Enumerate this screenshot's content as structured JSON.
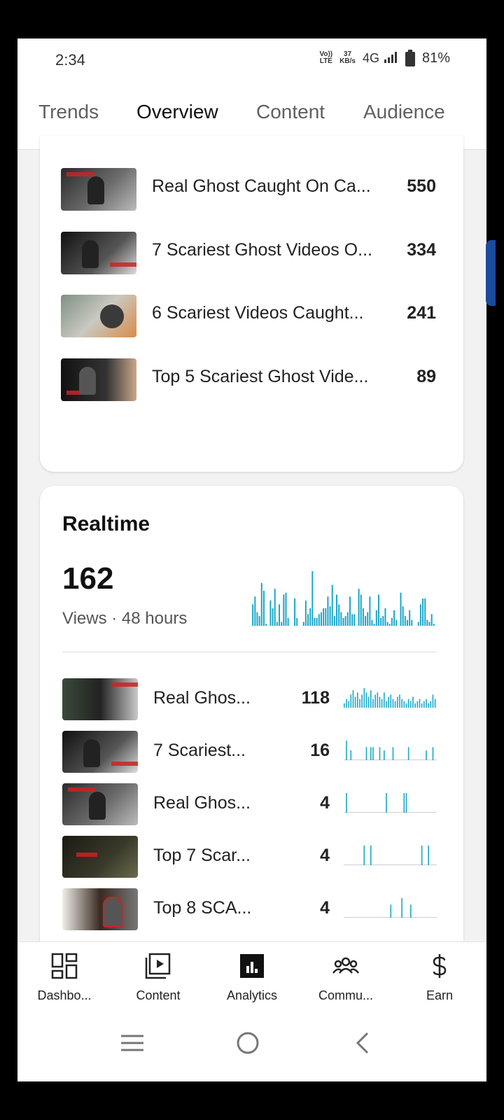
{
  "status_bar": {
    "time": "2:34",
    "volte": "Vo))",
    "lte": "LTE",
    "speed_value": "37",
    "speed_unit": "KB/s",
    "network": "4G",
    "battery": "81%"
  },
  "tabs": [
    {
      "label": "Trends"
    },
    {
      "label": "Overview"
    },
    {
      "label": "Content"
    },
    {
      "label": "Audience"
    }
  ],
  "active_tab": "Overview",
  "top_content": [
    {
      "title": "Real Ghost Caught On Ca...",
      "count": "550"
    },
    {
      "title": "7 Scariest Ghost Videos O...",
      "count": "334"
    },
    {
      "title": "6 Scariest Videos Caught...",
      "count": "241"
    },
    {
      "title": "Top 5 Scariest Ghost Vide...",
      "count": "89"
    }
  ],
  "realtime": {
    "title": "Realtime",
    "value": "162",
    "subtitle": "Views · 48 hours",
    "sparkline": [
      0,
      22,
      30,
      14,
      10,
      44,
      36,
      2,
      0,
      26,
      18,
      38,
      4,
      22,
      4,
      32,
      34,
      8,
      0,
      0,
      28,
      8,
      0,
      0,
      4,
      26,
      12,
      18,
      56,
      8,
      8,
      12,
      14,
      18,
      18,
      30,
      20,
      42,
      10,
      32,
      22,
      14,
      8,
      10,
      14,
      30,
      12,
      12,
      0,
      38,
      32,
      18,
      10,
      14,
      30,
      6,
      2,
      16,
      32,
      8,
      10,
      18,
      4,
      2,
      8,
      16,
      6,
      0,
      34,
      20,
      10,
      6,
      16,
      6,
      0,
      0,
      4,
      22,
      28,
      28,
      6,
      4,
      12,
      2
    ],
    "items": [
      {
        "title": "Real Ghos...",
        "count": "118",
        "spark": [
          4,
          8,
          6,
          12,
          16,
          10,
          14,
          8,
          12,
          18,
          14,
          10,
          16,
          8,
          12,
          14,
          10,
          8,
          14,
          6,
          10,
          12,
          8,
          6,
          10,
          12,
          8,
          6,
          4,
          8,
          6,
          10,
          4,
          6,
          8,
          4,
          6,
          8,
          4,
          6,
          12,
          8
        ]
      },
      {
        "title": "7 Scariest...",
        "count": "16",
        "spark": [
          0,
          6,
          0,
          3,
          0,
          0,
          0,
          0,
          0,
          0,
          4,
          0,
          4,
          4,
          0,
          0,
          4,
          0,
          3,
          0,
          0,
          0,
          4,
          0,
          0,
          0,
          0,
          0,
          0,
          4,
          0,
          0,
          0,
          0,
          0,
          0,
          0,
          3,
          0,
          0,
          4,
          0
        ]
      },
      {
        "title": "Real Ghos...",
        "count": "4",
        "spark": [
          0,
          4,
          0,
          0,
          0,
          0,
          0,
          0,
          0,
          0,
          0,
          0,
          0,
          0,
          0,
          0,
          0,
          0,
          0,
          4,
          0,
          0,
          0,
          0,
          0,
          0,
          0,
          4,
          4,
          0,
          0,
          0,
          0,
          0,
          0,
          0,
          0,
          0,
          0,
          0,
          0,
          0
        ]
      },
      {
        "title": "Top 7 Scar...",
        "count": "4",
        "spark": [
          0,
          0,
          0,
          0,
          0,
          0,
          0,
          0,
          0,
          4,
          0,
          0,
          4,
          0,
          0,
          0,
          0,
          0,
          0,
          0,
          0,
          0,
          0,
          0,
          0,
          0,
          0,
          0,
          0,
          0,
          0,
          0,
          0,
          0,
          0,
          4,
          0,
          0,
          4,
          0,
          0,
          0
        ]
      },
      {
        "title": "Top 8 SCA...",
        "count": "4",
        "spark": [
          0,
          0,
          0,
          0,
          0,
          0,
          0,
          0,
          0,
          0,
          0,
          0,
          0,
          0,
          0,
          0,
          0,
          0,
          0,
          0,
          0,
          4,
          0,
          0,
          0,
          0,
          6,
          0,
          0,
          0,
          4,
          0,
          0,
          0,
          0,
          0,
          0,
          0,
          0,
          0,
          0,
          0
        ]
      }
    ]
  },
  "bottom_nav": [
    {
      "label": "Dashbo...",
      "icon": "dashboard-icon"
    },
    {
      "label": "Content",
      "icon": "content-icon"
    },
    {
      "label": "Analytics",
      "icon": "analytics-icon",
      "active": true
    },
    {
      "label": "Commu...",
      "icon": "community-icon"
    },
    {
      "label": "Earn",
      "icon": "earn-icon"
    }
  ],
  "colors": {
    "accent": "#1aa7c9",
    "text": "#111111",
    "muted": "#606060"
  }
}
